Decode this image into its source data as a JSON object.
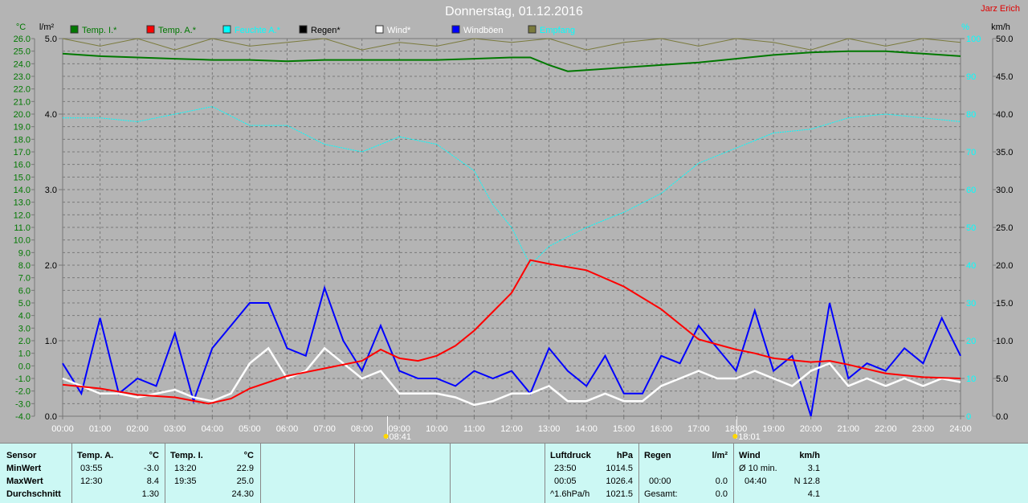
{
  "header": {
    "title": "Donnerstag, 01.12.2016",
    "author": "Jarz Erich"
  },
  "colors": {
    "temp_i": "#007800",
    "temp_a": "#ff0000",
    "feuchte": "#00ffff",
    "regen": "#000000",
    "wind": "#ffffff",
    "windboeen": "#0000ff",
    "empfang": "#7a7a3c"
  },
  "chart_data": {
    "type": "line",
    "title": "Donnerstag, 01.12.2016",
    "axes": {
      "temp": {
        "unit": "°C",
        "range": [
          -4,
          26
        ],
        "ticks": [
          "26.0",
          "25.0",
          "24.0",
          "23.0",
          "22.0",
          "21.0",
          "20.0",
          "19.0",
          "18.0",
          "17.0",
          "16.0",
          "15.0",
          "14.0",
          "13.0",
          "12.0",
          "11.0",
          "10.0",
          "9.0",
          "8.0",
          "7.0",
          "6.0",
          "5.0",
          "4.0",
          "3.0",
          "2.0",
          "1.0",
          "0.0",
          "-1.0",
          "-2.0",
          "-3.0",
          "-4.0"
        ]
      },
      "rain": {
        "unit": "l/m²",
        "range": [
          0,
          5
        ],
        "ticks": [
          "5.0",
          "4.0",
          "3.0",
          "2.0",
          "1.0",
          "0.0"
        ]
      },
      "humidity": {
        "unit": "%",
        "range": [
          0,
          100
        ],
        "ticks": [
          "100",
          "90",
          "80",
          "70",
          "60",
          "50",
          "40",
          "30",
          "20",
          "10",
          "0"
        ]
      },
      "wind": {
        "unit": "km/h",
        "range": [
          0,
          50
        ],
        "ticks": [
          "50.0",
          "45.0",
          "40.0",
          "35.0",
          "30.0",
          "25.0",
          "20.0",
          "15.0",
          "10.0",
          "5.0",
          "0.0"
        ]
      },
      "x": {
        "range": [
          0,
          24
        ],
        "ticks": [
          "00:00",
          "01:00",
          "02:00",
          "03:00",
          "04:00",
          "05:00",
          "06:00",
          "07:00",
          "08:00",
          "09:00",
          "10:00",
          "11:00",
          "12:00",
          "13:00",
          "14:00",
          "15:00",
          "16:00",
          "17:00",
          "18:00",
          "19:00",
          "20:00",
          "21:00",
          "22:00",
          "23:00",
          "24:00"
        ]
      }
    },
    "sunrise": "08:41",
    "sunset": "18:01",
    "legend": [
      {
        "label": "Temp. I.*",
        "key": "temp_i"
      },
      {
        "label": "Temp. A.*",
        "key": "temp_a"
      },
      {
        "label": "Feuchte A.*",
        "key": "feuchte"
      },
      {
        "label": "Regen*",
        "key": "regen"
      },
      {
        "label": "Wind*",
        "key": "wind"
      },
      {
        "label": "Windböen",
        "key": "windboeen"
      },
      {
        "label": "Empfang",
        "key": "empfang"
      }
    ],
    "series": [
      {
        "name": "Temp. I.",
        "key": "temp_i",
        "axis": "temp",
        "x": [
          0,
          1,
          2,
          3,
          4,
          5,
          6,
          7,
          8,
          9,
          10,
          11,
          12,
          12.5,
          13,
          13.5,
          14,
          15,
          16,
          17,
          18,
          19,
          20,
          21,
          22,
          23,
          24
        ],
        "y": [
          24.8,
          24.6,
          24.5,
          24.4,
          24.3,
          24.3,
          24.2,
          24.3,
          24.3,
          24.3,
          24.3,
          24.4,
          24.5,
          24.5,
          23.9,
          23.4,
          23.5,
          23.7,
          23.9,
          24.1,
          24.4,
          24.7,
          24.9,
          25.0,
          25.0,
          24.8,
          24.6
        ]
      },
      {
        "name": "Temp. A.",
        "key": "temp_a",
        "axis": "temp",
        "x": [
          0,
          1,
          2,
          3,
          3.9,
          4.5,
          5,
          6,
          7,
          8,
          8.5,
          9,
          9.5,
          10,
          10.5,
          11,
          11.5,
          12,
          12.5,
          13,
          14,
          15,
          16,
          17,
          18,
          18.5,
          19,
          20,
          20.5,
          21,
          22,
          23,
          24
        ],
        "y": [
          -1.5,
          -1.8,
          -2.3,
          -2.5,
          -3.0,
          -2.6,
          -1.8,
          -0.8,
          -0.2,
          0.4,
          1.3,
          0.6,
          0.4,
          0.8,
          1.6,
          2.8,
          4.3,
          5.8,
          8.4,
          8.1,
          7.6,
          6.3,
          4.5,
          2.1,
          1.3,
          1.0,
          0.6,
          0.3,
          0.4,
          0.1,
          -0.6,
          -0.9,
          -1.0
        ]
      },
      {
        "name": "Feuchte A.",
        "key": "feuchte",
        "axis": "humidity",
        "x": [
          0,
          1,
          2,
          3,
          4,
          5,
          6,
          7,
          8,
          9,
          10,
          11,
          11.5,
          12,
          12.5,
          13,
          14,
          15,
          16,
          17,
          18,
          19,
          20,
          21,
          22,
          23,
          24
        ],
        "y": [
          79,
          79,
          78,
          80,
          82,
          77,
          77,
          72,
          70,
          74,
          72,
          65,
          56,
          50,
          40,
          45,
          50,
          54,
          59,
          67,
          71,
          75,
          76,
          79,
          80,
          79,
          78
        ]
      },
      {
        "name": "Wind",
        "key": "wind",
        "axis": "wind",
        "x": [
          0,
          0.5,
          1,
          1.5,
          2,
          2.5,
          3,
          3.5,
          4,
          4.5,
          5,
          5.5,
          6,
          6.5,
          7,
          7.5,
          8,
          8.5,
          9,
          9.5,
          10,
          10.5,
          11,
          11.5,
          12,
          12.5,
          13,
          13.5,
          14,
          14.5,
          15,
          15.5,
          16,
          16.5,
          17,
          17.5,
          18,
          18.5,
          19,
          19.5,
          20,
          20.5,
          21,
          21.5,
          22,
          22.5,
          23,
          23.5,
          24
        ],
        "y": [
          5,
          4,
          3,
          3,
          2.5,
          3,
          3.5,
          2.5,
          2,
          3,
          7,
          9,
          5,
          6,
          9,
          7,
          5,
          6,
          3,
          3,
          3,
          2.5,
          1.5,
          2,
          3,
          3,
          4,
          2,
          2,
          3,
          2,
          2,
          4,
          5,
          6,
          5,
          5,
          6,
          5,
          4,
          6,
          7,
          4,
          5,
          4,
          5,
          4,
          5,
          4.5
        ]
      },
      {
        "name": "Windböen",
        "key": "windboeen",
        "axis": "wind",
        "x": [
          0,
          0.5,
          1,
          1.5,
          2,
          2.5,
          3,
          3.5,
          4,
          4.5,
          5,
          5.5,
          6,
          6.5,
          7,
          7.5,
          8,
          8.5,
          9,
          9.5,
          10,
          10.5,
          11,
          11.5,
          12,
          12.5,
          13,
          13.5,
          14,
          14.5,
          15,
          15.5,
          16,
          16.5,
          17,
          17.5,
          18,
          18.5,
          19,
          19.5,
          20,
          20.5,
          21,
          21.5,
          22,
          22.5,
          23,
          23.5,
          24
        ],
        "y": [
          7,
          3,
          13,
          3,
          5,
          4,
          11,
          2,
          9,
          12,
          15,
          15,
          9,
          8,
          17,
          10,
          6,
          12,
          6,
          5,
          5,
          4,
          6,
          5,
          6,
          3,
          9,
          6,
          4,
          8,
          3,
          3,
          8,
          7,
          12,
          9,
          6,
          14,
          6,
          8,
          0,
          15,
          5,
          7,
          6,
          9,
          7,
          13,
          8
        ]
      },
      {
        "name": "Empfang",
        "key": "empfang",
        "axis": "humidity",
        "x": [
          0,
          1,
          2,
          3,
          4,
          5,
          6,
          7,
          8,
          9,
          10,
          11,
          12,
          13,
          14,
          15,
          16,
          17,
          18,
          19,
          20,
          21,
          22,
          23,
          24
        ],
        "y": [
          100,
          98,
          100,
          97,
          100,
          98,
          99,
          100,
          97,
          99,
          98,
          100,
          99,
          100,
          97,
          99,
          100,
          98,
          100,
          99,
          97,
          100,
          98,
          100,
          99
        ]
      }
    ]
  },
  "table": {
    "sensor": {
      "header": "Sensor",
      "rows": [
        "MinWert",
        "MaxWert",
        "Durchschnitt"
      ]
    },
    "temp_a": {
      "header": "Temp. A.",
      "unit": "°C",
      "min_time": "03:55",
      "min": "-3.0",
      "max_time": "12:30",
      "max": "8.4",
      "avg": "1.30"
    },
    "temp_i": {
      "header": "Temp. I.",
      "unit": "°C",
      "min_time": "13:20",
      "min": "22.9",
      "max_time": "19:35",
      "max": "25.0",
      "avg": "24.30"
    },
    "luftdruck": {
      "header": "Luftdruck",
      "unit": "hPa",
      "min_time": "23:50",
      "min": "1014.5",
      "max_time": "00:05",
      "max": "1026.4",
      "trend": "^1.6hPa/h",
      "avg": "1021.5"
    },
    "regen": {
      "header": "Regen",
      "unit": "l/m²",
      "max_time": "00:00",
      "max": "0.0",
      "total_label": "Gesamt:",
      "total": "0.0"
    },
    "wind": {
      "header": "Wind",
      "unit": "km/h",
      "avg10_label": "Ø 10 min.",
      "avg10": "3.1",
      "max_time": "04:40",
      "max": "N 12.8",
      "avg": "4.1"
    }
  }
}
